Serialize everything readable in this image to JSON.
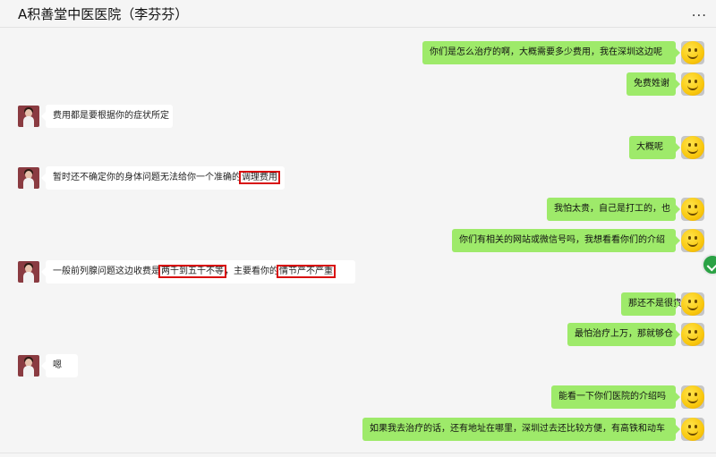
{
  "window": {
    "title": "A积善堂中医医院（李芬芬）",
    "menu_icon": "more-dots-icon",
    "menu_glyph": "..."
  },
  "colors": {
    "sent_bubble": "#9eea6a",
    "received_bubble": "#ffffff",
    "highlight_box": "#d80f0f",
    "background": "#f5f5f5"
  },
  "messages": [
    {
      "side": "right",
      "parts": [
        {
          "text": "你们是怎么治疗的啊，大概需要多少费用，我在深圳这边呢",
          "highlight": false
        }
      ]
    },
    {
      "side": "right",
      "parts": [
        {
          "text": "免费姓谢",
          "highlight": false
        }
      ]
    },
    {
      "side": "left",
      "parts": [
        {
          "text": "费用都是要根据你的症状所定",
          "highlight": false
        }
      ]
    },
    {
      "side": "right",
      "parts": [
        {
          "text": "大概呢",
          "highlight": false
        }
      ]
    },
    {
      "side": "left",
      "parts": [
        {
          "text": "暂时还不确定你的身体问题无法给你一个准确的",
          "highlight": false
        },
        {
          "text": "调理费用",
          "highlight": true
        }
      ]
    },
    {
      "side": "right",
      "parts": [
        {
          "text": "我怕太贵，自己是打工的，也",
          "highlight": false
        }
      ]
    },
    {
      "side": "right",
      "parts": [
        {
          "text": "你们有相关的网站或微信号吗，我想看看你们的介绍",
          "highlight": false
        }
      ]
    },
    {
      "side": "left",
      "parts": [
        {
          "text": "一般前列腺问题这边收费是",
          "highlight": false
        },
        {
          "text": "两千到五千不等",
          "highlight": true
        },
        {
          "text": "，主要看你的",
          "highlight": false
        },
        {
          "text": "情节严不严重",
          "highlight": true
        }
      ]
    },
    {
      "side": "right",
      "parts": [
        {
          "text": "那还不是很贵",
          "highlight": false
        }
      ]
    },
    {
      "side": "right",
      "parts": [
        {
          "text": "最怕治疗上万，那就够仓",
          "highlight": false
        }
      ]
    },
    {
      "side": "left",
      "parts": [
        {
          "text": "嗯",
          "highlight": false
        }
      ]
    },
    {
      "side": "right",
      "parts": [
        {
          "text": "能看一下你们医院的介绍吗",
          "highlight": false
        }
      ]
    },
    {
      "side": "right",
      "parts": [
        {
          "text": "如果我去治疗的话，还有地址在哪里，深圳过去还比较方便，有高铁和动车",
          "highlight": false
        }
      ]
    }
  ]
}
